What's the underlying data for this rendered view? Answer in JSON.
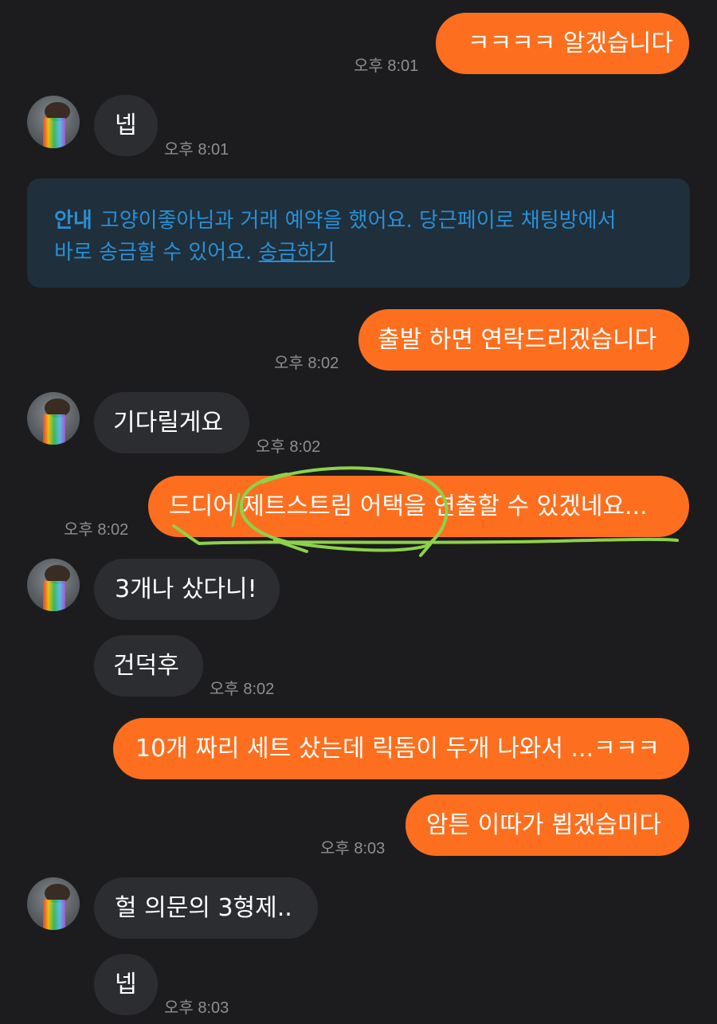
{
  "messages": [
    {
      "text": "ㅋㅋㅋㅋ 알겠습니다",
      "time": "오후 8:01"
    },
    {
      "text": "넵",
      "time": "오후 8:01"
    },
    {
      "text": "출발 하면 연락드리겠습니다",
      "time": "오후 8:02"
    },
    {
      "text": "기다릴게요",
      "time": "오후 8:02"
    },
    {
      "text": "드디어 제트스트림 어택을 연출할 수 있겠네요...",
      "time": "오후 8:02"
    },
    {
      "text": "3개나 샀다니!",
      "time": ""
    },
    {
      "text": "건덕후",
      "time": "오후 8:02"
    },
    {
      "text": "10개 짜리 세트 샀는데 릭돔이 두개 나와서 ...ㅋㅋㅋ",
      "time": ""
    },
    {
      "text": "암튼 이따가 뵙겠습미다",
      "time": "오후 8:03"
    },
    {
      "text": "헐 의문의 3형제..",
      "time": ""
    },
    {
      "text": "넵",
      "time": "오후 8:03"
    }
  ],
  "notice": {
    "label": "안내",
    "line1": "고양이좋아님과 거래 예약을 했어요. 당근페이로 채팅방에서",
    "line2": "바로 송금할 수 있어요.",
    "link": "송금하기"
  },
  "colors": {
    "background": "#1c1c1e",
    "my_bubble": "#fd6f1f",
    "their_bubble": "#2c2d31",
    "notice_bg": "#1f2f3c",
    "notice_text": "#2a8fd4",
    "annotation": "#8cd24a"
  },
  "icons": {
    "avatar": "cat-avatar-icon",
    "annotation": "green-circle-underline-annotation"
  }
}
